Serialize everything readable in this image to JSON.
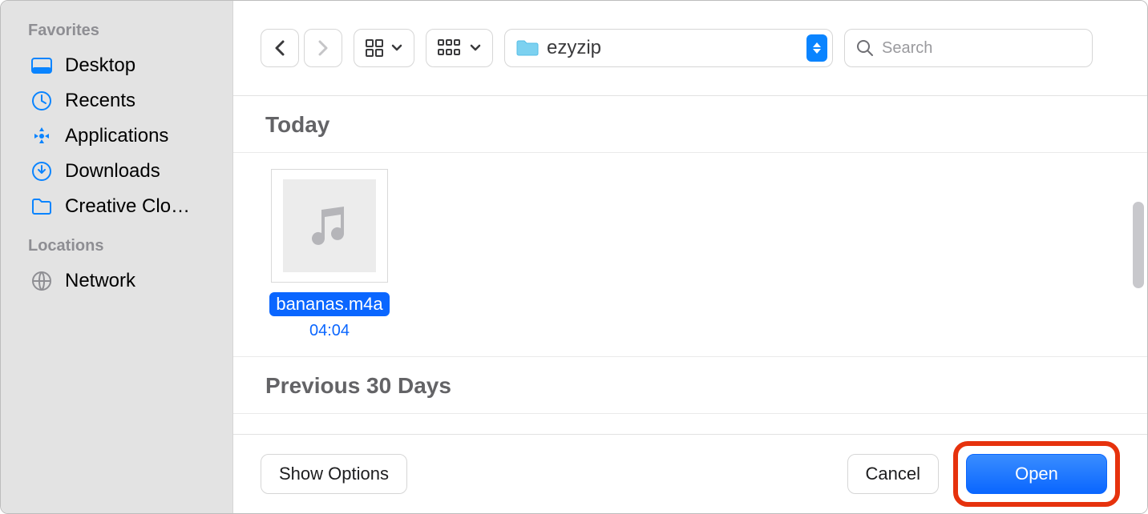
{
  "sidebar": {
    "sections": [
      {
        "title": "Favorites",
        "items": [
          {
            "icon": "desktop",
            "label": "Desktop"
          },
          {
            "icon": "clock",
            "label": "Recents"
          },
          {
            "icon": "apps",
            "label": "Applications"
          },
          {
            "icon": "download",
            "label": "Downloads"
          },
          {
            "icon": "folder",
            "label": "Creative Clo…"
          }
        ]
      },
      {
        "title": "Locations",
        "items": [
          {
            "icon": "globe",
            "label": "Network"
          }
        ]
      }
    ]
  },
  "toolbar": {
    "location": "ezyzip",
    "search_placeholder": "Search"
  },
  "content": {
    "sections": [
      {
        "title": "Today",
        "files": [
          {
            "name": "bananas.m4a",
            "duration": "04:04",
            "kind": "audio",
            "selected": true
          }
        ]
      },
      {
        "title": "Previous 30 Days",
        "files": []
      }
    ]
  },
  "actions": {
    "options": "Show Options",
    "cancel": "Cancel",
    "open": "Open"
  }
}
